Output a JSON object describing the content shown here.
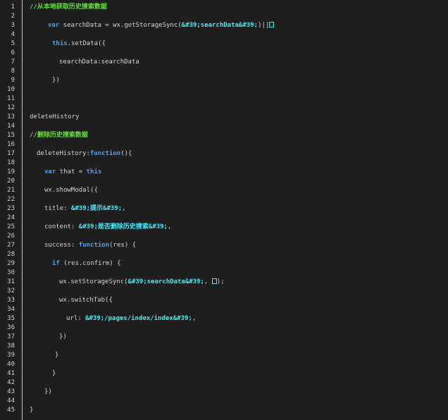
{
  "editor": {
    "colors": {
      "background": "#1e1e1e",
      "plain": "#d4d4d4",
      "comment": "#6adf3f",
      "keyword": "#3fa7ff",
      "string": "#3ff0ff",
      "gutter_text": "#d0d0d0",
      "gutter_border": "#c8c8c8"
    },
    "line_numbers": [
      "1",
      "2",
      "3",
      "4",
      "5",
      "6",
      "7",
      "8",
      "9",
      "10",
      "11",
      "12",
      "13",
      "14",
      "15",
      "16",
      "17",
      "18",
      "19",
      "20",
      "21",
      "22",
      "23",
      "24",
      "25",
      "26",
      "27",
      "28",
      "29",
      "30",
      "31",
      "32",
      "33",
      "34",
      "35",
      "36",
      "37",
      "38",
      "39",
      "40",
      "41",
      "42",
      "43",
      "44",
      "45"
    ],
    "lines": [
      {
        "indent": 10,
        "tokens": [
          {
            "t": "comment",
            "v": "//从本地获取历史搜索数据"
          }
        ]
      },
      {
        "indent": 0,
        "tokens": []
      },
      {
        "indent": 36,
        "tokens": [
          {
            "t": "keyword",
            "v": "var"
          },
          {
            "t": "plain",
            "v": " searchData = wx.getStorageSync("
          },
          {
            "t": "string",
            "v": "&#39;searchData&#39;"
          },
          {
            "t": "plain",
            "v": ")||"
          },
          {
            "t": "box",
            "v": "["
          }
        ]
      },
      {
        "indent": 0,
        "tokens": []
      },
      {
        "indent": 42,
        "tokens": [
          {
            "t": "keyword",
            "v": "this"
          },
          {
            "t": "plain",
            "v": ".setData({"
          }
        ]
      },
      {
        "indent": 0,
        "tokens": []
      },
      {
        "indent": 52,
        "tokens": [
          {
            "t": "plain",
            "v": "searchData:searchData"
          }
        ]
      },
      {
        "indent": 0,
        "tokens": []
      },
      {
        "indent": 42,
        "tokens": [
          {
            "t": "plain",
            "v": "})"
          }
        ]
      },
      {
        "indent": 0,
        "tokens": []
      },
      {
        "indent": 0,
        "tokens": []
      },
      {
        "indent": 0,
        "tokens": []
      },
      {
        "indent": 10,
        "tokens": [
          {
            "t": "plain",
            "v": "deleteHistory"
          }
        ]
      },
      {
        "indent": 0,
        "tokens": []
      },
      {
        "indent": 10,
        "tokens": [
          {
            "t": "comment",
            "v": "//删除历史搜索数据"
          }
        ]
      },
      {
        "indent": 0,
        "tokens": []
      },
      {
        "indent": 20,
        "tokens": [
          {
            "t": "plain",
            "v": "deleteHistory:"
          },
          {
            "t": "keyword",
            "v": "function"
          },
          {
            "t": "plain",
            "v": "(){"
          }
        ]
      },
      {
        "indent": 0,
        "tokens": []
      },
      {
        "indent": 31,
        "tokens": [
          {
            "t": "keyword",
            "v": "var"
          },
          {
            "t": "plain",
            "v": " that = "
          },
          {
            "t": "keyword",
            "v": "this"
          }
        ]
      },
      {
        "indent": 0,
        "tokens": []
      },
      {
        "indent": 31,
        "tokens": [
          {
            "t": "plain",
            "v": "wx.showModal({"
          }
        ]
      },
      {
        "indent": 0,
        "tokens": []
      },
      {
        "indent": 31,
        "tokens": [
          {
            "t": "plain",
            "v": "title: "
          },
          {
            "t": "string",
            "v": "&#39;提示&#39;"
          },
          {
            "t": "plain",
            "v": ","
          }
        ]
      },
      {
        "indent": 0,
        "tokens": []
      },
      {
        "indent": 31,
        "tokens": [
          {
            "t": "plain",
            "v": "content: "
          },
          {
            "t": "string",
            "v": "&#39;是否删除历史搜索&#39;"
          },
          {
            "t": "plain",
            "v": ","
          }
        ]
      },
      {
        "indent": 0,
        "tokens": []
      },
      {
        "indent": 31,
        "tokens": [
          {
            "t": "plain",
            "v": "success: "
          },
          {
            "t": "keyword",
            "v": "function"
          },
          {
            "t": "plain",
            "v": "(res) {"
          }
        ]
      },
      {
        "indent": 0,
        "tokens": []
      },
      {
        "indent": 42,
        "tokens": [
          {
            "t": "keyword",
            "v": "if"
          },
          {
            "t": "plain",
            "v": " (res.confirm) {"
          }
        ]
      },
      {
        "indent": 0,
        "tokens": []
      },
      {
        "indent": 52,
        "tokens": [
          {
            "t": "plain",
            "v": "wx.setStorageSync("
          },
          {
            "t": "string",
            "v": "&#39;searchData&#39;"
          },
          {
            "t": "plain",
            "v": ", "
          },
          {
            "t": "box",
            "v": "["
          },
          {
            "t": "plain",
            "v": ");"
          }
        ]
      },
      {
        "indent": 0,
        "tokens": []
      },
      {
        "indent": 52,
        "tokens": [
          {
            "t": "plain",
            "v": "wx.switchTab({"
          }
        ]
      },
      {
        "indent": 0,
        "tokens": []
      },
      {
        "indent": 62,
        "tokens": [
          {
            "t": "plain",
            "v": "url: "
          },
          {
            "t": "string",
            "v": "&#39;/pages/index/index&#39;"
          },
          {
            "t": "plain",
            "v": ","
          }
        ]
      },
      {
        "indent": 0,
        "tokens": []
      },
      {
        "indent": 52,
        "tokens": [
          {
            "t": "plain",
            "v": "})"
          }
        ]
      },
      {
        "indent": 0,
        "tokens": []
      },
      {
        "indent": 46,
        "tokens": [
          {
            "t": "plain",
            "v": "}"
          }
        ]
      },
      {
        "indent": 0,
        "tokens": []
      },
      {
        "indent": 42,
        "tokens": [
          {
            "t": "plain",
            "v": "}"
          }
        ]
      },
      {
        "indent": 0,
        "tokens": []
      },
      {
        "indent": 31,
        "tokens": [
          {
            "t": "plain",
            "v": "})"
          }
        ]
      },
      {
        "indent": 0,
        "tokens": []
      },
      {
        "indent": 10,
        "tokens": [
          {
            "t": "plain",
            "v": "}"
          }
        ]
      }
    ]
  }
}
